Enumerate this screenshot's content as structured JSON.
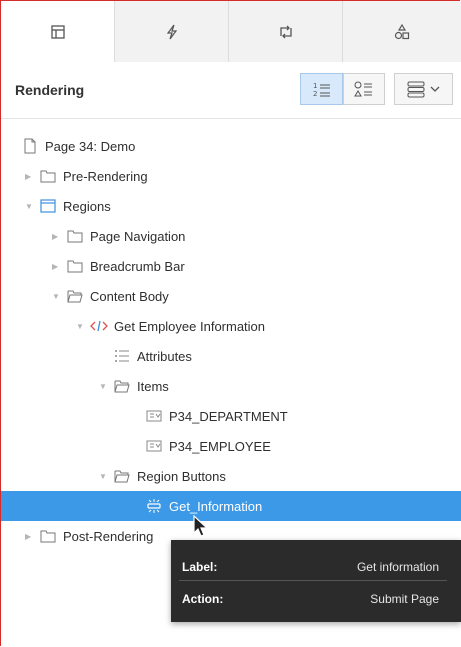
{
  "tabs": [
    {
      "icon": "rendering-tree-icon"
    },
    {
      "icon": "dynamic-actions-icon"
    },
    {
      "icon": "processing-icon"
    },
    {
      "icon": "shared-components-icon"
    }
  ],
  "toolbar": {
    "title": "Rendering"
  },
  "tree": {
    "page": "Page 34: Demo",
    "pre_rendering": "Pre-Rendering",
    "regions": "Regions",
    "page_navigation": "Page Navigation",
    "breadcrumb_bar": "Breadcrumb Bar",
    "content_body": "Content Body",
    "region": "Get Employee Information",
    "attributes": "Attributes",
    "items": "Items",
    "item1": "P34_DEPARTMENT",
    "item2": "P34_EMPLOYEE",
    "region_buttons": "Region Buttons",
    "button": "Get_Information",
    "post_rendering": "Post-Rendering"
  },
  "tooltip": {
    "label_key": "Label:",
    "label_value": "Get information",
    "action_key": "Action:",
    "action_value": "Submit Page"
  },
  "colors": {
    "selection": "#3b99e7",
    "frame": "#d62b2b",
    "tooltip_bg": "#2b2b2b"
  }
}
